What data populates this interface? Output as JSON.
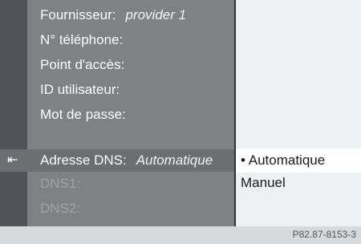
{
  "settings": {
    "rows": [
      {
        "label": "Fournisseur:",
        "value": "provider 1"
      },
      {
        "label": "N° téléphone:",
        "value": ""
      },
      {
        "label": "Point d'accès:",
        "value": ""
      },
      {
        "label": "ID utilisateur:",
        "value": ""
      },
      {
        "label": "Mot de passe:",
        "value": ""
      },
      {
        "label": "Adresse DNS:",
        "value": "Automatique"
      },
      {
        "label": "DNS1:",
        "value": ""
      },
      {
        "label": "DNS2:",
        "value": ""
      }
    ],
    "back_icon": "back-arrow-icon"
  },
  "submenu": {
    "items": [
      {
        "label": "• Automatique"
      },
      {
        "label": "Manuel"
      }
    ]
  },
  "reference": "P82.87-8153-3"
}
